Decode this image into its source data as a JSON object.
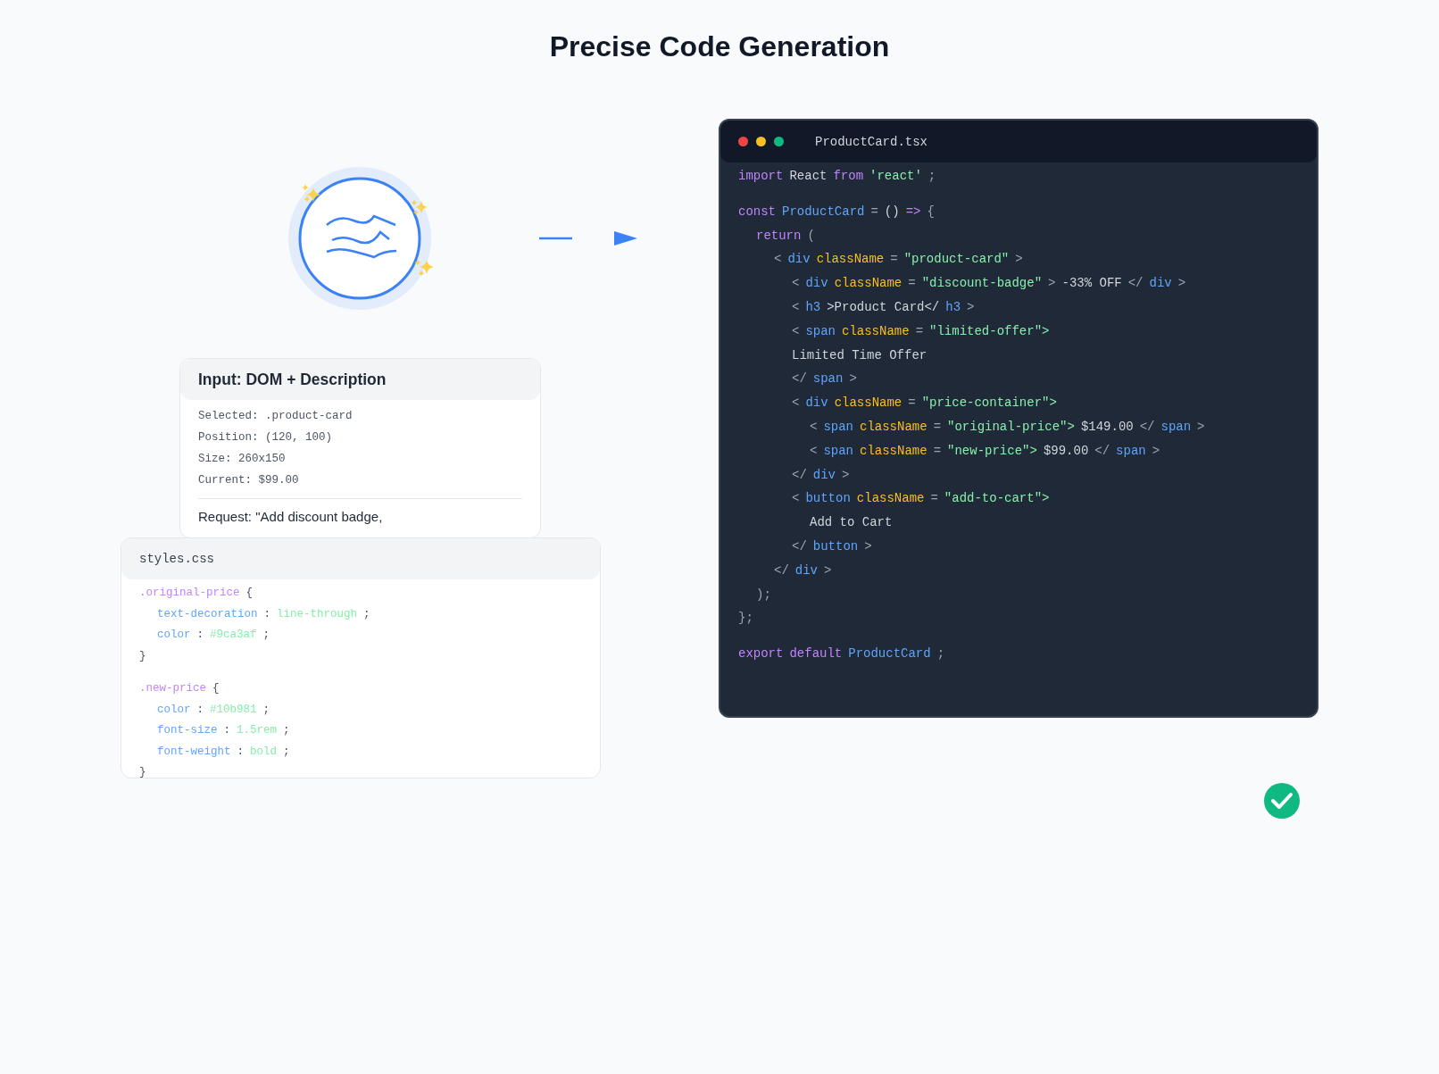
{
  "title": "Precise Code Generation",
  "input_card": {
    "title": "Input: DOM + Description",
    "fields": [
      "Selected: .product-card",
      "Position: (120, 100)",
      "Size: 260x150",
      "Current: $99.00"
    ],
    "request": "Request: \"Add discount badge,"
  },
  "css_card": {
    "filename": "styles.css",
    "rules": [
      {
        "tokens": [
          {
            "t": ".original-price",
            "kind": "selector"
          },
          {
            "t": "{",
            "kind": "punct"
          }
        ],
        "children": [
          {
            "tokens": [
              {
                "t": "text-decoration",
                "kind": "prop"
              },
              {
                "t": ":",
                "kind": "punct"
              },
              {
                "t": "line-through",
                "kind": "value"
              },
              {
                "t": ";",
                "kind": "punct"
              }
            ]
          },
          {
            "tokens": [
              {
                "t": "color",
                "kind": "prop"
              },
              {
                "t": ":",
                "kind": "punct"
              },
              {
                "t": "#9ca3af",
                "kind": "value"
              },
              {
                "t": ";",
                "kind": "punct"
              }
            ]
          }
        ]
      },
      {
        "tokens": [
          {
            "t": "}",
            "kind": "punct"
          }
        ]
      },
      {
        "tokens": [
          {
            "t": ".new-price",
            "kind": "selector"
          },
          {
            "t": "{",
            "kind": "punct"
          }
        ],
        "gap": true,
        "children": [
          {
            "tokens": [
              {
                "t": "color",
                "kind": "prop"
              },
              {
                "t": ":",
                "kind": "punct"
              },
              {
                "t": "#10b981",
                "kind": "value"
              },
              {
                "t": ";",
                "kind": "punct"
              }
            ]
          },
          {
            "tokens": [
              {
                "t": "font-size",
                "kind": "prop"
              },
              {
                "t": ":",
                "kind": "punct"
              },
              {
                "t": "1.5rem",
                "kind": "value"
              },
              {
                "t": ";",
                "kind": "punct"
              }
            ]
          },
          {
            "tokens": [
              {
                "t": "font-weight",
                "kind": "prop"
              },
              {
                "t": ":",
                "kind": "punct"
              },
              {
                "t": "bold",
                "kind": "value"
              },
              {
                "t": ";",
                "kind": "punct"
              }
            ]
          }
        ]
      },
      {
        "tokens": [
          {
            "t": "}",
            "kind": "punct"
          }
        ]
      }
    ]
  },
  "code_window": {
    "filename": "ProductCard.tsx",
    "lines": [
      {
        "tokens": [
          {
            "t": "import",
            "kind": "keyword"
          },
          {
            "t": "React",
            "kind": "plain"
          },
          {
            "t": "from",
            "kind": "keyword"
          },
          {
            "t": "'react'",
            "kind": "string"
          },
          {
            "t": ";",
            "kind": "punct"
          }
        ]
      },
      {
        "gap": true,
        "tokens": [
          {
            "t": "const",
            "kind": "keyword"
          },
          {
            "t": "ProductCard",
            "kind": "tag"
          },
          {
            "t": "=",
            "kind": "punct"
          },
          {
            "t": "()",
            "kind": "plain"
          },
          {
            "t": "=>",
            "kind": "keyword"
          },
          {
            "t": "{",
            "kind": "punct"
          }
        ],
        "children": [
          {
            "tokens": [
              {
                "t": "return",
                "kind": "keyword"
              },
              {
                "t": "(",
                "kind": "punct"
              }
            ],
            "children": [
              {
                "tokens": [
                  {
                    "t": "<",
                    "kind": "punct"
                  },
                  {
                    "t": "div",
                    "kind": "tag"
                  },
                  {
                    "t": "className",
                    "kind": "attr"
                  },
                  {
                    "t": "=",
                    "kind": "punct"
                  },
                  {
                    "t": "\"product-card\"",
                    "kind": "string"
                  },
                  {
                    "t": ">",
                    "kind": "punct"
                  }
                ],
                "children": [
                  {
                    "tokens": [
                      {
                        "t": "<",
                        "kind": "punct"
                      },
                      {
                        "t": "div",
                        "kind": "tag"
                      },
                      {
                        "t": "className",
                        "kind": "attr"
                      },
                      {
                        "t": "=",
                        "kind": "punct"
                      },
                      {
                        "t": "\"discount-badge\"",
                        "kind": "string"
                      },
                      {
                        "t": ">",
                        "kind": "punct"
                      },
                      {
                        "t": "-33% OFF",
                        "kind": "plain"
                      },
                      {
                        "t": "</",
                        "kind": "punct"
                      },
                      {
                        "t": "div",
                        "kind": "tag"
                      },
                      {
                        "t": ">",
                        "kind": "punct"
                      }
                    ]
                  },
                  {
                    "tokens": [
                      {
                        "t": "<",
                        "kind": "punct"
                      },
                      {
                        "t": "h3",
                        "kind": "tag"
                      },
                      {
                        "t": ">Product Card</",
                        "kind": "plain"
                      },
                      {
                        "t": "h3",
                        "kind": "tag"
                      },
                      {
                        "t": ">",
                        "kind": "punct"
                      }
                    ]
                  },
                  {
                    "tokens": [
                      {
                        "t": "<",
                        "kind": "punct"
                      },
                      {
                        "t": "span",
                        "kind": "tag"
                      },
                      {
                        "t": "className",
                        "kind": "attr"
                      },
                      {
                        "t": "=",
                        "kind": "punct"
                      },
                      {
                        "t": "\"limited-offer\">",
                        "kind": "string"
                      }
                    ]
                  },
                  {
                    "tokens": [
                      {
                        "t": "Limited Time Offer",
                        "kind": "plain"
                      }
                    ]
                  },
                  {
                    "tokens": [
                      {
                        "t": "</",
                        "kind": "punct"
                      },
                      {
                        "t": "span",
                        "kind": "tag"
                      },
                      {
                        "t": ">",
                        "kind": "punct"
                      }
                    ]
                  },
                  {
                    "tokens": [
                      {
                        "t": "<",
                        "kind": "punct"
                      },
                      {
                        "t": "div",
                        "kind": "tag"
                      },
                      {
                        "t": "className",
                        "kind": "attr"
                      },
                      {
                        "t": "=",
                        "kind": "punct"
                      },
                      {
                        "t": "\"price-container\">",
                        "kind": "string"
                      }
                    ],
                    "children": [
                      {
                        "tokens": [
                          {
                            "t": "<",
                            "kind": "punct"
                          },
                          {
                            "t": "span",
                            "kind": "tag"
                          },
                          {
                            "t": "className",
                            "kind": "attr"
                          },
                          {
                            "t": "=",
                            "kind": "punct"
                          },
                          {
                            "t": "\"original-price\">",
                            "kind": "string"
                          },
                          {
                            "t": "$149.00",
                            "kind": "plain"
                          },
                          {
                            "t": "</",
                            "kind": "punct"
                          },
                          {
                            "t": "span",
                            "kind": "tag"
                          },
                          {
                            "t": ">",
                            "kind": "punct"
                          }
                        ]
                      },
                      {
                        "tokens": [
                          {
                            "t": "<",
                            "kind": "punct"
                          },
                          {
                            "t": "span",
                            "kind": "tag"
                          },
                          {
                            "t": "className",
                            "kind": "attr"
                          },
                          {
                            "t": "=",
                            "kind": "punct"
                          },
                          {
                            "t": "\"new-price\">",
                            "kind": "string"
                          },
                          {
                            "t": "$99.00",
                            "kind": "plain"
                          },
                          {
                            "t": "</",
                            "kind": "punct"
                          },
                          {
                            "t": "span",
                            "kind": "tag"
                          },
                          {
                            "t": ">",
                            "kind": "punct"
                          }
                        ]
                      }
                    ]
                  },
                  {
                    "tokens": [
                      {
                        "t": "</",
                        "kind": "punct"
                      },
                      {
                        "t": "div",
                        "kind": "tag"
                      },
                      {
                        "t": ">",
                        "kind": "punct"
                      }
                    ]
                  },
                  {
                    "tokens": [
                      {
                        "t": "<",
                        "kind": "punct"
                      },
                      {
                        "t": "button",
                        "kind": "tag"
                      },
                      {
                        "t": "className",
                        "kind": "attr"
                      },
                      {
                        "t": "=",
                        "kind": "punct"
                      },
                      {
                        "t": "\"add-to-cart\">",
                        "kind": "string"
                      }
                    ],
                    "children": [
                      {
                        "tokens": [
                          {
                            "t": "Add to Cart",
                            "kind": "plain"
                          }
                        ]
                      }
                    ]
                  },
                  {
                    "tokens": [
                      {
                        "t": "</",
                        "kind": "punct"
                      },
                      {
                        "t": "button",
                        "kind": "tag"
                      },
                      {
                        "t": ">",
                        "kind": "punct"
                      }
                    ]
                  }
                ]
              },
              {
                "tokens": [
                  {
                    "t": "</",
                    "kind": "punct"
                  },
                  {
                    "t": "div",
                    "kind": "tag"
                  },
                  {
                    "t": ">",
                    "kind": "punct"
                  }
                ]
              }
            ]
          },
          {
            "tokens": [
              {
                "t": ");",
                "kind": "punct"
              }
            ]
          }
        ]
      },
      {
        "tokens": [
          {
            "t": "};",
            "kind": "punct"
          }
        ]
      },
      {
        "gap": true,
        "tokens": [
          {
            "t": "export",
            "kind": "keyword"
          },
          {
            "t": "default",
            "kind": "keyword"
          },
          {
            "t": "ProductCard",
            "kind": "tag"
          },
          {
            "t": ";",
            "kind": "punct"
          }
        ]
      }
    ]
  }
}
